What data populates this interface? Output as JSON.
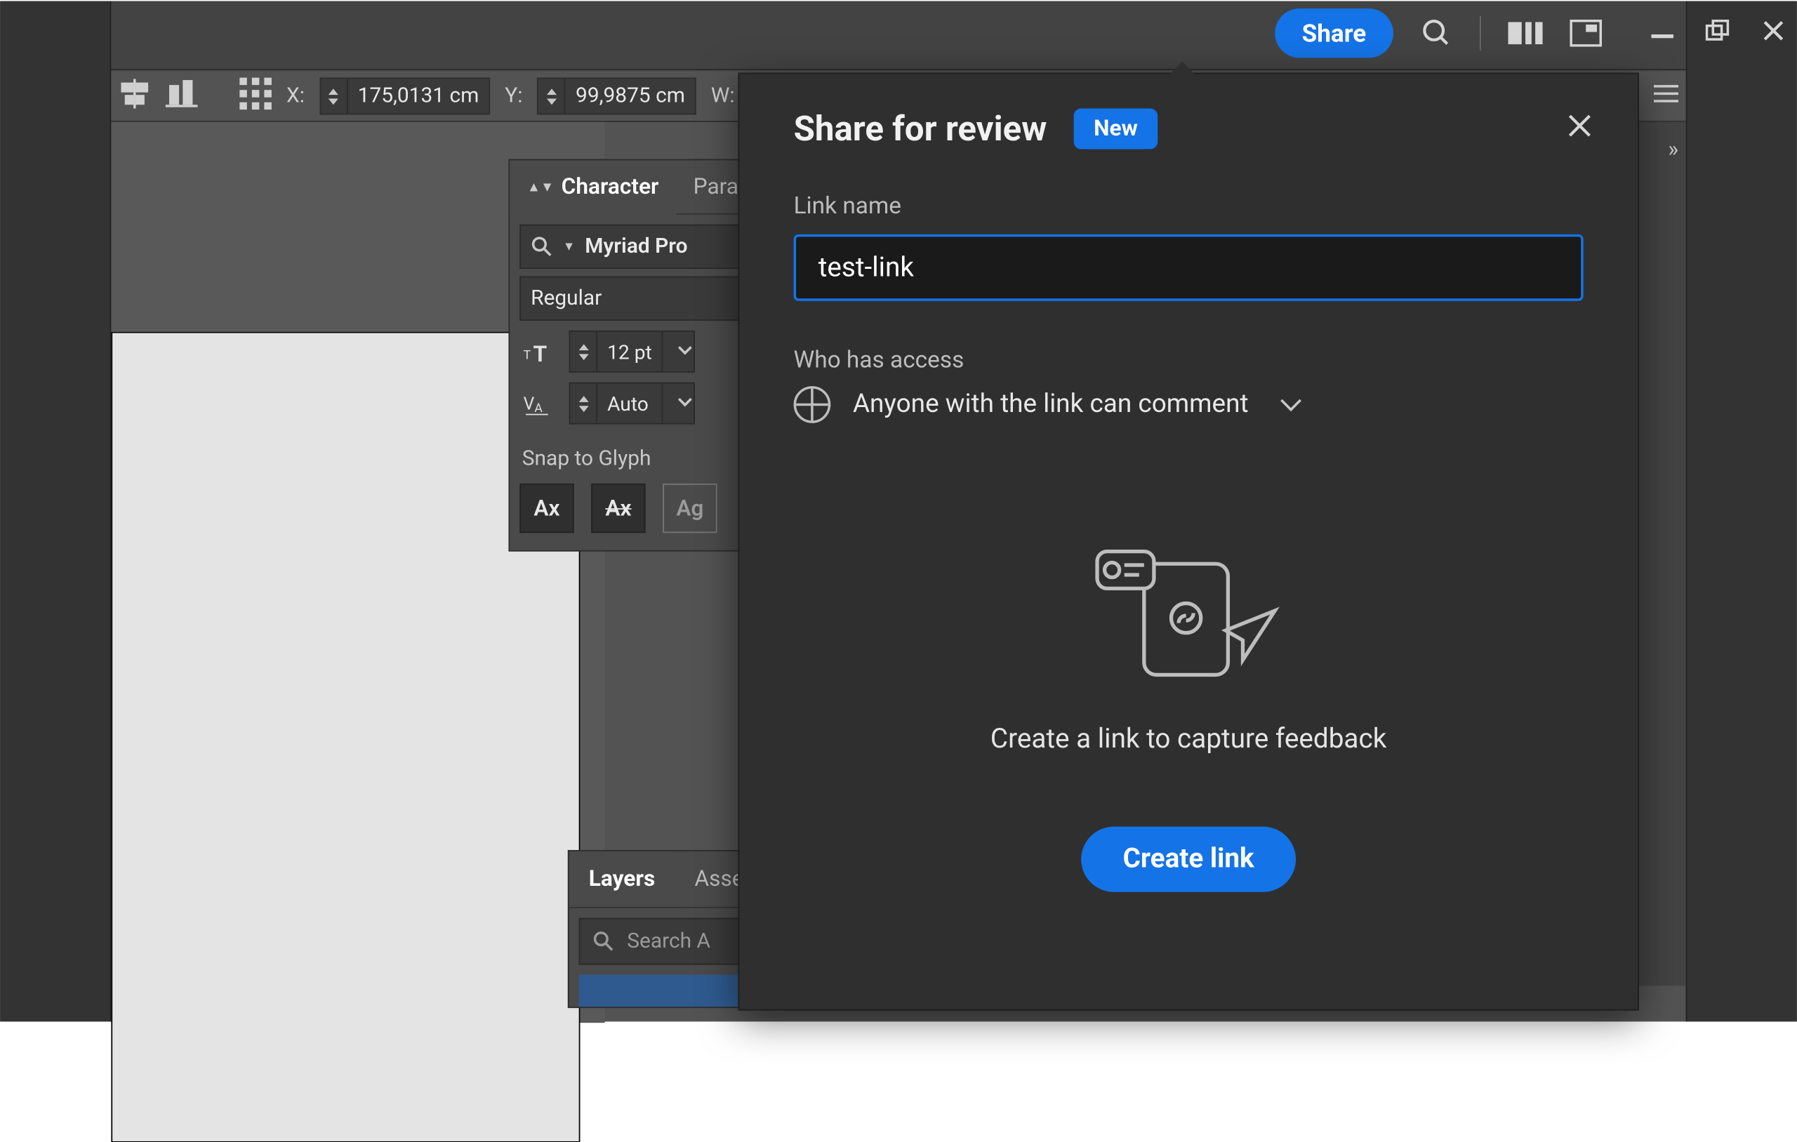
{
  "topbar": {
    "share_label": "Share"
  },
  "controls": {
    "x_label": "X:",
    "x_value": "175,0131 cm",
    "y_label": "Y:",
    "y_value": "99,9875 cm",
    "w_label": "W:"
  },
  "character_panel": {
    "tab_character": "Character",
    "tab_paragraph": "Paragr",
    "font_family": "Myriad Pro",
    "font_style": "Regular",
    "font_size": "12 pt",
    "kerning": "Auto",
    "snap_label": "Snap to Glyph",
    "glyph1": "Ax",
    "glyph2": "Ax",
    "glyph3": "Ag"
  },
  "layers_panel": {
    "tab_layers": "Layers",
    "tab_assets": "Asse",
    "search_placeholder": "Search A"
  },
  "share_modal": {
    "title": "Share for review",
    "badge": "New",
    "link_name_label": "Link name",
    "link_name_value": "test-link",
    "access_label": "Who has access",
    "access_value": "Anyone with the link can comment",
    "illus_caption": "Create a link to capture feedback",
    "create_button": "Create link"
  }
}
